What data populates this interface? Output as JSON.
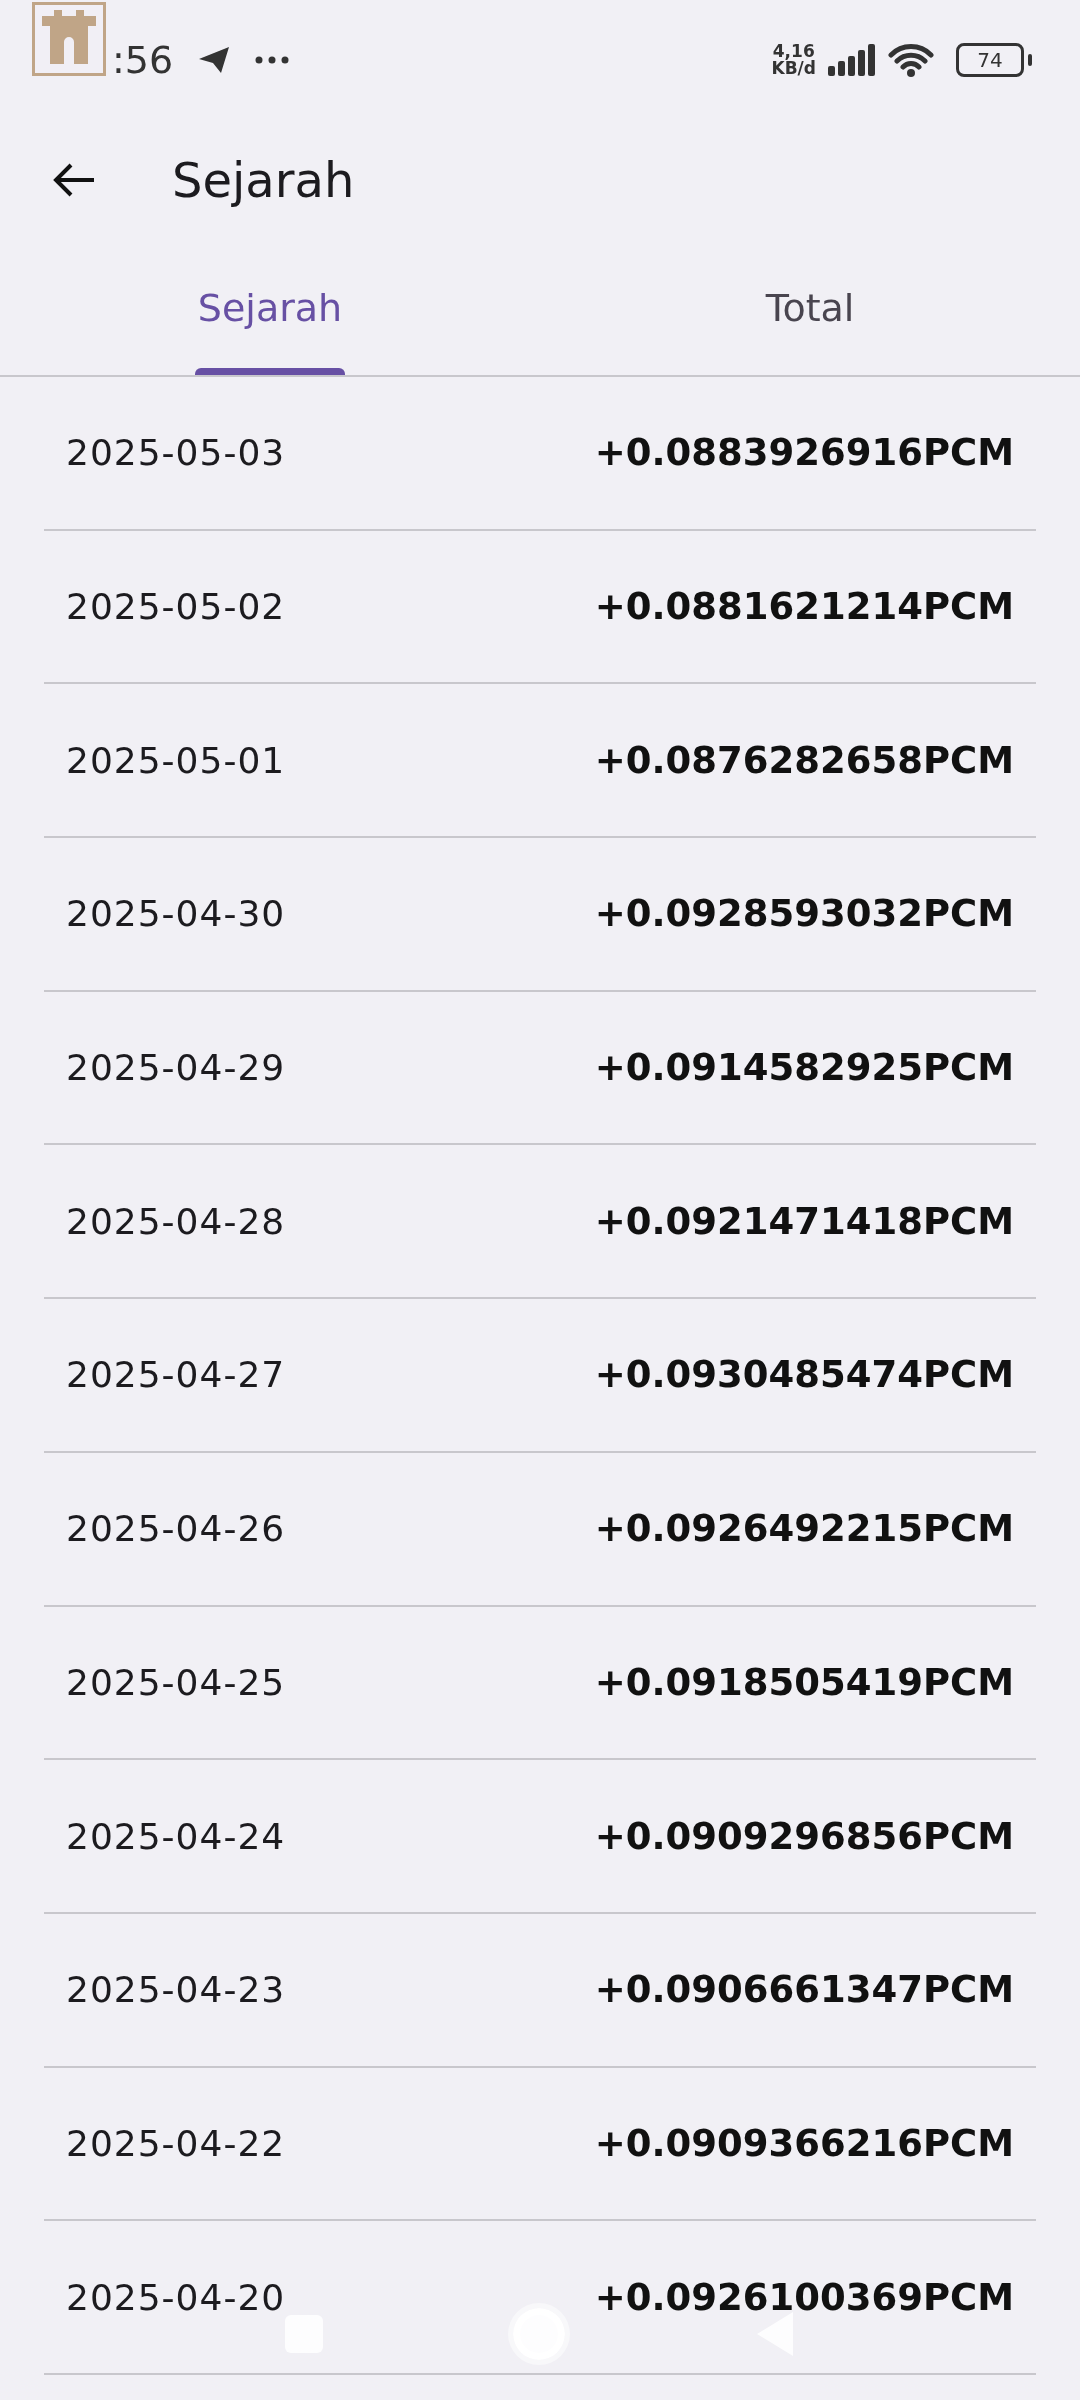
{
  "status_bar": {
    "time": ":56",
    "net_speed": "4,16",
    "net_unit": "KB/d",
    "battery": "74"
  },
  "app_bar": {
    "title": "Sejarah"
  },
  "tabs": [
    {
      "label": "Sejarah",
      "selected": true
    },
    {
      "label": "Total",
      "selected": false
    }
  ],
  "rows": [
    {
      "date": "2025-05-03",
      "amount": "+0.0883926916PCM"
    },
    {
      "date": "2025-05-02",
      "amount": "+0.0881621214PCM"
    },
    {
      "date": "2025-05-01",
      "amount": "+0.0876282658PCM"
    },
    {
      "date": "2025-04-30",
      "amount": "+0.0928593032PCM"
    },
    {
      "date": "2025-04-29",
      "amount": "+0.0914582925PCM"
    },
    {
      "date": "2025-04-28",
      "amount": "+0.0921471418PCM"
    },
    {
      "date": "2025-04-27",
      "amount": "+0.0930485474PCM"
    },
    {
      "date": "2025-04-26",
      "amount": "+0.0926492215PCM"
    },
    {
      "date": "2025-04-25",
      "amount": "+0.0918505419PCM"
    },
    {
      "date": "2025-04-24",
      "amount": "+0.0909296856PCM"
    },
    {
      "date": "2025-04-23",
      "amount": "+0.0906661347PCM"
    },
    {
      "date": "2025-04-22",
      "amount": "+0.0909366216PCM"
    },
    {
      "date": "2025-04-20",
      "amount": "+0.0926100369PCM"
    }
  ]
}
